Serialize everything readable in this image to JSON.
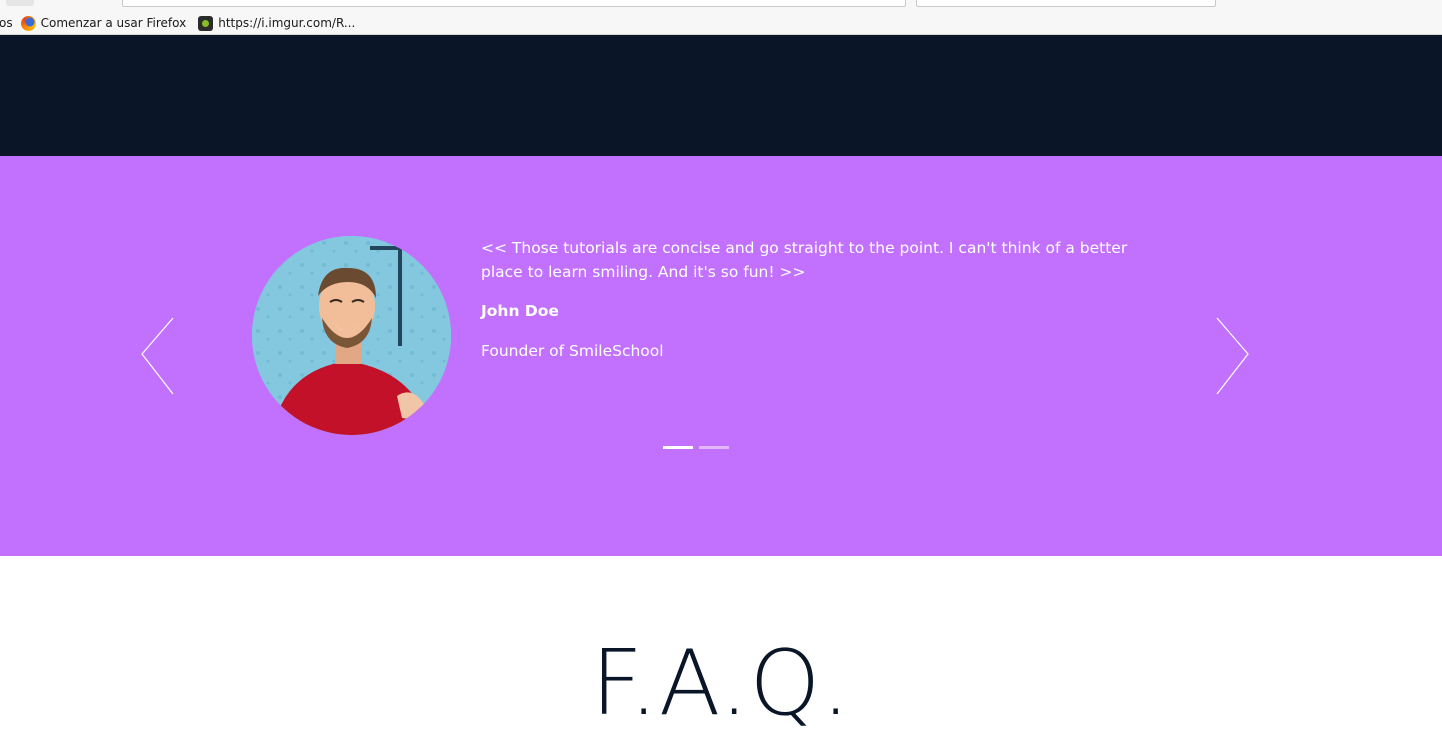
{
  "browser": {
    "overflow_label": "os",
    "bookmarks": [
      {
        "label": "Comenzar a usar Firefox",
        "icon": "firefox-icon"
      },
      {
        "label": "https://i.imgur.com/R...",
        "icon": "imgur-icon"
      }
    ]
  },
  "testimonial": {
    "quote": "<< Those tutorials are concise and go straight to the point. I can't think of a better place to learn smiling. And it's so fun! >>",
    "name": "John Doe",
    "role": "Founder of SmileSchool",
    "indicators": [
      true,
      false
    ],
    "colors": {
      "background": "#c271ff",
      "text": "#ffffff"
    }
  },
  "dark_band": {
    "color": "#0a1628"
  },
  "faq": {
    "title": "F.A.Q."
  }
}
